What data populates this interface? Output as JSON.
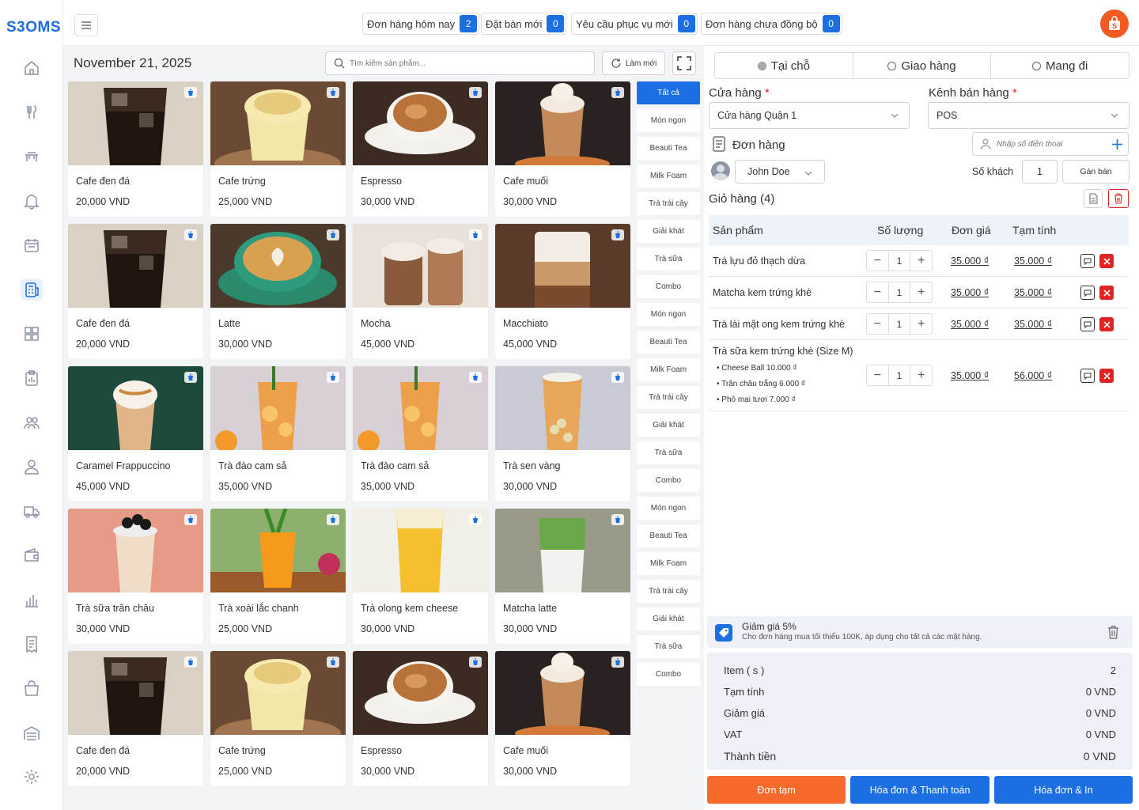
{
  "app": {
    "logo": "S3OMS"
  },
  "sidebar": {
    "items": [
      "home-icon",
      "utensils-icon",
      "table-icon",
      "bell-icon",
      "calendar-icon",
      "pos-icon",
      "grid-icon",
      "clipboard-icon",
      "group-icon",
      "user-icon",
      "truck-icon",
      "wallet-icon",
      "chart-icon",
      "receipt-icon",
      "bag-icon",
      "warehouse-icon",
      "settings-icon"
    ],
    "active": "pos-icon"
  },
  "topbar": {
    "chips": [
      {
        "label": "Đơn hàng hôm nay",
        "count": "2"
      },
      {
        "label": "Đặt bàn mới",
        "count": "0"
      },
      {
        "label": "Yêu cầu phục vụ mới",
        "count": "0"
      },
      {
        "label": "Đơn hàng chưa đồng bộ",
        "count": "0"
      }
    ]
  },
  "products_area": {
    "date": "November 21, 2025",
    "search_placeholder": "Tìm kiếm sản phẩm...",
    "refresh_label": "Làm mới",
    "products": [
      {
        "name": "Cafe đen đá",
        "price": "20,000 VND",
        "img": "iced-black"
      },
      {
        "name": "Cafe trứng",
        "price": "25,000 VND",
        "img": "egg"
      },
      {
        "name": "Espresso",
        "price": "30,000 VND",
        "img": "espresso"
      },
      {
        "name": "Cafe muối",
        "price": "30,000 VND",
        "img": "salt"
      },
      {
        "name": "Cafe đen đá",
        "price": "20,000 VND",
        "img": "iced-black"
      },
      {
        "name": "Latte",
        "price": "30,000 VND",
        "img": "latte"
      },
      {
        "name": "Mocha",
        "price": "45,000 VND",
        "img": "mocha"
      },
      {
        "name": "Macchiato",
        "price": "45,000 VND",
        "img": "macchiato"
      },
      {
        "name": "Caramel Frappuccino",
        "price": "45,000 VND",
        "img": "frappe"
      },
      {
        "name": "Trà đào cam sả",
        "price": "35,000 VND",
        "img": "peach"
      },
      {
        "name": "Trà đào cam sả",
        "price": "35,000 VND",
        "img": "peach"
      },
      {
        "name": "Trà sen vàng",
        "price": "30,000 VND",
        "img": "lotus"
      },
      {
        "name": "Trà sữa trân châu",
        "price": "30,000 VND",
        "img": "boba"
      },
      {
        "name": "Trà xoài lắc chanh",
        "price": "25,000 VND",
        "img": "mango"
      },
      {
        "name": "Trà olong kem cheese",
        "price": "30,000 VND",
        "img": "oolong"
      },
      {
        "name": "Matcha latte",
        "price": "30,000 VND",
        "img": "matcha"
      },
      {
        "name": "Cafe đen đá",
        "price": "20,000 VND",
        "img": "iced-black"
      },
      {
        "name": "Cafe trứng",
        "price": "25,000 VND",
        "img": "egg"
      },
      {
        "name": "Espresso",
        "price": "30,000 VND",
        "img": "espresso"
      },
      {
        "name": "Cafe muối",
        "price": "30,000 VND",
        "img": "salt"
      }
    ],
    "categories": [
      "Tất cả",
      "Món ngon",
      "Beauti Tea",
      "Milk Foam",
      "Trà trái cây",
      "Giải khát",
      "Trà sữa",
      "Combo",
      "Món ngon",
      "Beauti Tea",
      "Milk Foam",
      "Trà trái cây",
      "Giải khát",
      "Trà sữa",
      "Combo",
      "Món ngon",
      "Beauti Tea",
      "Milk Foam",
      "Trà trái cây",
      "Giải khát",
      "Trà sữa",
      "Combo"
    ]
  },
  "order_panel": {
    "tabs": [
      "Tại chỗ",
      "Giao hàng",
      "Mang đi"
    ],
    "active_tab": "Tại chỗ",
    "store_label": "Cửa hàng",
    "store_value": "Cửa hàng Quận 1",
    "channel_label": "Kênh bán hàng",
    "channel_value": "POS",
    "required_mark": "*",
    "order_label": "Đơn hàng",
    "phone_placeholder": "Nhập số điện thoại",
    "staff_name": "John Doe",
    "guests_label": "Số khách",
    "guests_value": "1",
    "assign_table": "Gán bàn",
    "cart_title": "Giỏ hàng (4)",
    "columns": {
      "product": "Sản phẩm",
      "qty": "Số lượng",
      "unit_price": "Đơn giá",
      "subtotal": "Tạm tính"
    },
    "items": [
      {
        "name": "Trà lựu đỏ thạch dừa",
        "qty": "1",
        "price": "35.000 ₫",
        "subtotal": "35.000 ₫"
      },
      {
        "name": "Matcha kem trứng khè",
        "qty": "1",
        "price": "35.000 ₫",
        "subtotal": "35.000 ₫"
      },
      {
        "name": "Trà lài mật ong kem trứng khè",
        "qty": "1",
        "price": "35.000 ₫",
        "subtotal": "35.000 ₫"
      },
      {
        "name": "Trà sữa kem trứng khè (Size M)",
        "qty": "1",
        "price": "35.000 ₫",
        "subtotal": "56.000 ₫",
        "toppings": [
          "Cheese Ball 10.000 ₫",
          "Trân châu trắng 6.000 ₫",
          "Phô mai tươi 7.000 ₫"
        ]
      }
    ],
    "discount": {
      "title": "Giảm giá 5%",
      "desc": "Cho đơn hàng mua tối thiểu 100K, áp dụng cho tất cả các mặt hàng."
    },
    "summary": [
      {
        "label": "Item ( s )",
        "value": "2"
      },
      {
        "label": "Tạm tính",
        "value": "0 VND"
      },
      {
        "label": "Giảm giá",
        "value": "0 VND"
      },
      {
        "label": "VAT",
        "value": "0 VND"
      },
      {
        "label": "Thành tiền",
        "value": "0 VND"
      }
    ],
    "buttons": {
      "draft": "Đơn tạm",
      "invoice_pay": "Hóa đơn & Thanh toán",
      "invoice_print": "Hóa đơn & In"
    }
  },
  "colors": {
    "primary": "#1b6fe0",
    "orange": "#f66a2b",
    "danger": "#e02424",
    "logo": "#1b6fe0"
  }
}
